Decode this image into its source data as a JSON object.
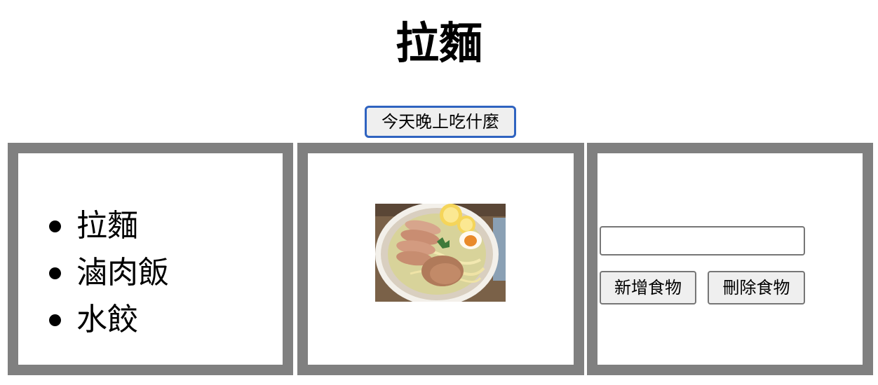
{
  "page_title": "拉麵",
  "pick_button_label": "今天晚上吃什麼",
  "food_list": [
    {
      "label": "拉麵"
    },
    {
      "label": "滷肉飯"
    },
    {
      "label": "水餃"
    }
  ],
  "selected_food_image": {
    "icon": "food-photo-ramen"
  },
  "input": {
    "value": "",
    "placeholder": ""
  },
  "add_button_label": "新增食物",
  "delete_button_label": "刪除食物",
  "colors": {
    "panel_border": "#808080",
    "focus_outline": "#2f63c0",
    "button_bg": "#efefef"
  }
}
